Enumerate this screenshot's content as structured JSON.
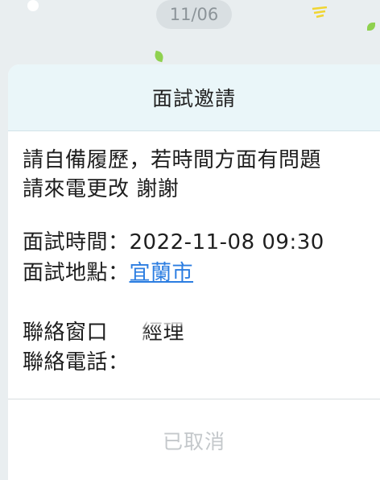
{
  "date_pill": "11/06",
  "card": {
    "title": "面試邀請",
    "message_line1": "請自備履歷，若時間方面有問題",
    "message_line2": "請來電更改 謝謝",
    "interview_time_label": "面試時間：",
    "interview_time_value": "2022-11-08 09:30",
    "interview_place_label": "面試地點：",
    "interview_place_value": "宜蘭市",
    "contact_window_label": "聯絡窗口",
    "contact_window_value": "經理",
    "contact_phone_label": "聯絡電話：",
    "footer_status": "已取消"
  },
  "colors": {
    "header_bg": "#eaf6f9",
    "link": "#2b7de1",
    "disabled_text": "#c4c8cb",
    "decoration_green": "#8fd14f",
    "decoration_yellow": "#f0d531"
  }
}
